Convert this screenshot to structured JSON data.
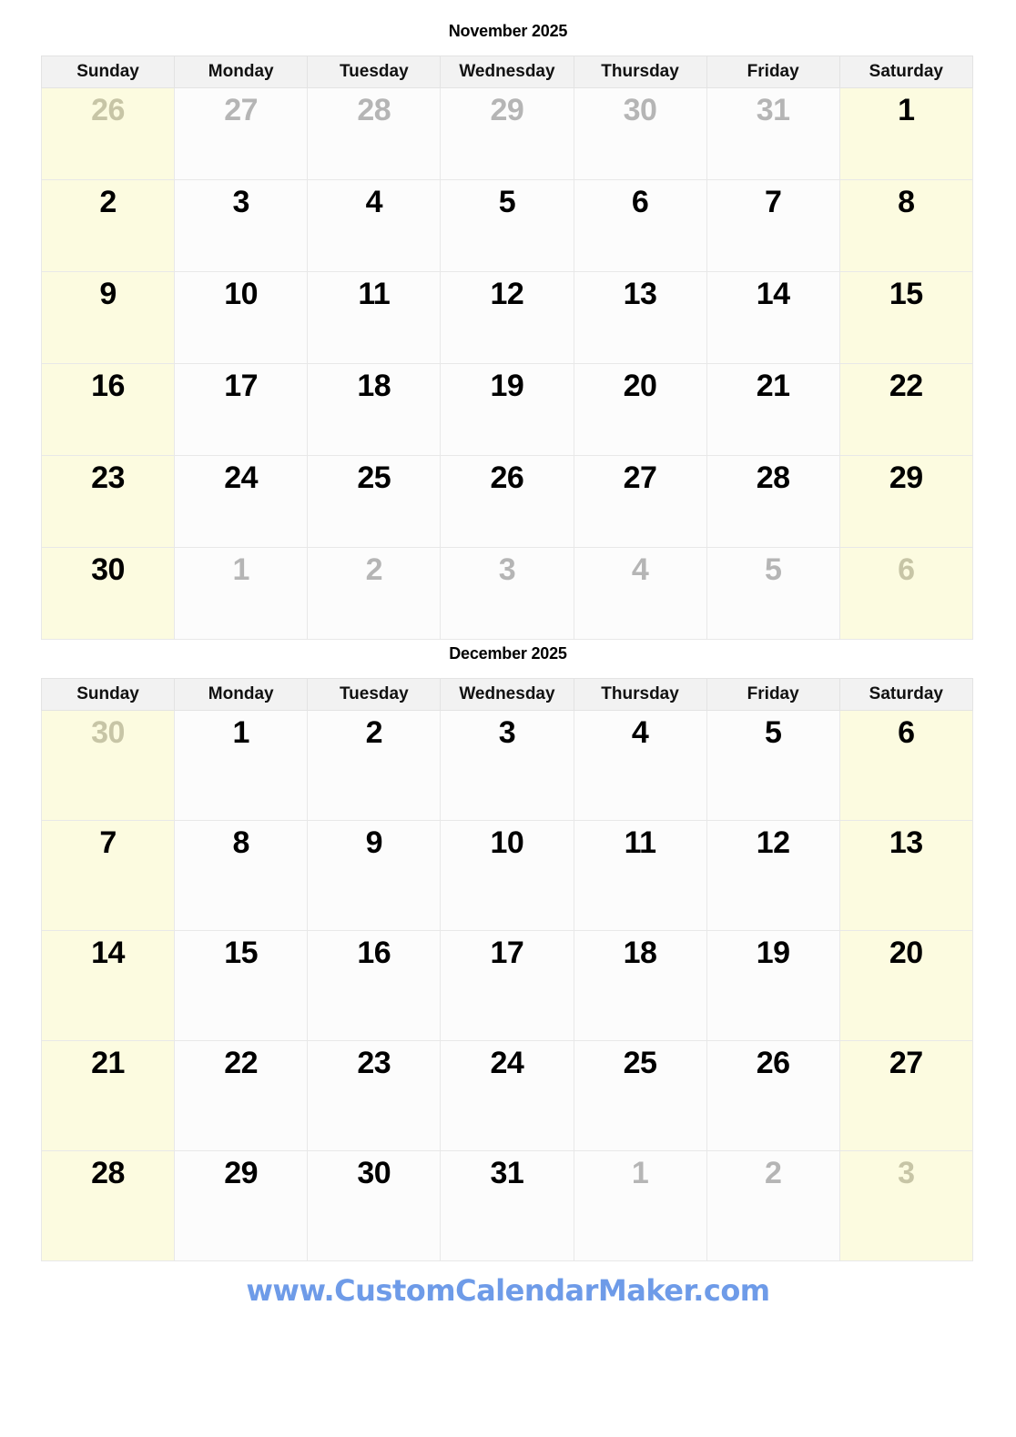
{
  "footer": {
    "url": "www.CustomCalendarMaker.com",
    "color": "#6E9BE8"
  },
  "colors": {
    "weekend_cell": "#FCFBE0",
    "weekday_cell": "#FCFCFC",
    "header_row": "#F2F2F2",
    "grid_line": "#E8E8E8",
    "in_month_text": "#000000",
    "out_month_text": "#B5B5B5",
    "out_month_text_on_weekend": "#C7C5A6"
  },
  "months": [
    {
      "title": "November 2025",
      "weekday_headers": [
        "Sunday",
        "Monday",
        "Tuesday",
        "Wednesday",
        "Thursday",
        "Friday",
        "Saturday"
      ],
      "weeks": [
        [
          {
            "day": "26",
            "in_month": false,
            "weekend": true
          },
          {
            "day": "27",
            "in_month": false,
            "weekend": false
          },
          {
            "day": "28",
            "in_month": false,
            "weekend": false
          },
          {
            "day": "29",
            "in_month": false,
            "weekend": false
          },
          {
            "day": "30",
            "in_month": false,
            "weekend": false
          },
          {
            "day": "31",
            "in_month": false,
            "weekend": false
          },
          {
            "day": "1",
            "in_month": true,
            "weekend": true
          }
        ],
        [
          {
            "day": "2",
            "in_month": true,
            "weekend": true
          },
          {
            "day": "3",
            "in_month": true,
            "weekend": false
          },
          {
            "day": "4",
            "in_month": true,
            "weekend": false
          },
          {
            "day": "5",
            "in_month": true,
            "weekend": false
          },
          {
            "day": "6",
            "in_month": true,
            "weekend": false
          },
          {
            "day": "7",
            "in_month": true,
            "weekend": false
          },
          {
            "day": "8",
            "in_month": true,
            "weekend": true
          }
        ],
        [
          {
            "day": "9",
            "in_month": true,
            "weekend": true
          },
          {
            "day": "10",
            "in_month": true,
            "weekend": false
          },
          {
            "day": "11",
            "in_month": true,
            "weekend": false
          },
          {
            "day": "12",
            "in_month": true,
            "weekend": false
          },
          {
            "day": "13",
            "in_month": true,
            "weekend": false
          },
          {
            "day": "14",
            "in_month": true,
            "weekend": false
          },
          {
            "day": "15",
            "in_month": true,
            "weekend": true
          }
        ],
        [
          {
            "day": "16",
            "in_month": true,
            "weekend": true
          },
          {
            "day": "17",
            "in_month": true,
            "weekend": false
          },
          {
            "day": "18",
            "in_month": true,
            "weekend": false
          },
          {
            "day": "19",
            "in_month": true,
            "weekend": false
          },
          {
            "day": "20",
            "in_month": true,
            "weekend": false
          },
          {
            "day": "21",
            "in_month": true,
            "weekend": false
          },
          {
            "day": "22",
            "in_month": true,
            "weekend": true
          }
        ],
        [
          {
            "day": "23",
            "in_month": true,
            "weekend": true
          },
          {
            "day": "24",
            "in_month": true,
            "weekend": false
          },
          {
            "day": "25",
            "in_month": true,
            "weekend": false
          },
          {
            "day": "26",
            "in_month": true,
            "weekend": false
          },
          {
            "day": "27",
            "in_month": true,
            "weekend": false
          },
          {
            "day": "28",
            "in_month": true,
            "weekend": false
          },
          {
            "day": "29",
            "in_month": true,
            "weekend": true
          }
        ],
        [
          {
            "day": "30",
            "in_month": true,
            "weekend": true
          },
          {
            "day": "1",
            "in_month": false,
            "weekend": false
          },
          {
            "day": "2",
            "in_month": false,
            "weekend": false
          },
          {
            "day": "3",
            "in_month": false,
            "weekend": false
          },
          {
            "day": "4",
            "in_month": false,
            "weekend": false
          },
          {
            "day": "5",
            "in_month": false,
            "weekend": false
          },
          {
            "day": "6",
            "in_month": false,
            "weekend": true
          }
        ]
      ]
    },
    {
      "title": "December 2025",
      "weekday_headers": [
        "Sunday",
        "Monday",
        "Tuesday",
        "Wednesday",
        "Thursday",
        "Friday",
        "Saturday"
      ],
      "weeks": [
        [
          {
            "day": "30",
            "in_month": false,
            "weekend": true
          },
          {
            "day": "1",
            "in_month": true,
            "weekend": false
          },
          {
            "day": "2",
            "in_month": true,
            "weekend": false
          },
          {
            "day": "3",
            "in_month": true,
            "weekend": false
          },
          {
            "day": "4",
            "in_month": true,
            "weekend": false
          },
          {
            "day": "5",
            "in_month": true,
            "weekend": false
          },
          {
            "day": "6",
            "in_month": true,
            "weekend": true
          }
        ],
        [
          {
            "day": "7",
            "in_month": true,
            "weekend": true
          },
          {
            "day": "8",
            "in_month": true,
            "weekend": false
          },
          {
            "day": "9",
            "in_month": true,
            "weekend": false
          },
          {
            "day": "10",
            "in_month": true,
            "weekend": false
          },
          {
            "day": "11",
            "in_month": true,
            "weekend": false
          },
          {
            "day": "12",
            "in_month": true,
            "weekend": false
          },
          {
            "day": "13",
            "in_month": true,
            "weekend": true
          }
        ],
        [
          {
            "day": "14",
            "in_month": true,
            "weekend": true
          },
          {
            "day": "15",
            "in_month": true,
            "weekend": false
          },
          {
            "day": "16",
            "in_month": true,
            "weekend": false
          },
          {
            "day": "17",
            "in_month": true,
            "weekend": false
          },
          {
            "day": "18",
            "in_month": true,
            "weekend": false
          },
          {
            "day": "19",
            "in_month": true,
            "weekend": false
          },
          {
            "day": "20",
            "in_month": true,
            "weekend": true
          }
        ],
        [
          {
            "day": "21",
            "in_month": true,
            "weekend": true
          },
          {
            "day": "22",
            "in_month": true,
            "weekend": false
          },
          {
            "day": "23",
            "in_month": true,
            "weekend": false
          },
          {
            "day": "24",
            "in_month": true,
            "weekend": false
          },
          {
            "day": "25",
            "in_month": true,
            "weekend": false
          },
          {
            "day": "26",
            "in_month": true,
            "weekend": false
          },
          {
            "day": "27",
            "in_month": true,
            "weekend": true
          }
        ],
        [
          {
            "day": "28",
            "in_month": true,
            "weekend": true
          },
          {
            "day": "29",
            "in_month": true,
            "weekend": false
          },
          {
            "day": "30",
            "in_month": true,
            "weekend": false
          },
          {
            "day": "31",
            "in_month": true,
            "weekend": false
          },
          {
            "day": "1",
            "in_month": false,
            "weekend": false
          },
          {
            "day": "2",
            "in_month": false,
            "weekend": false
          },
          {
            "day": "3",
            "in_month": false,
            "weekend": true
          }
        ]
      ]
    }
  ]
}
